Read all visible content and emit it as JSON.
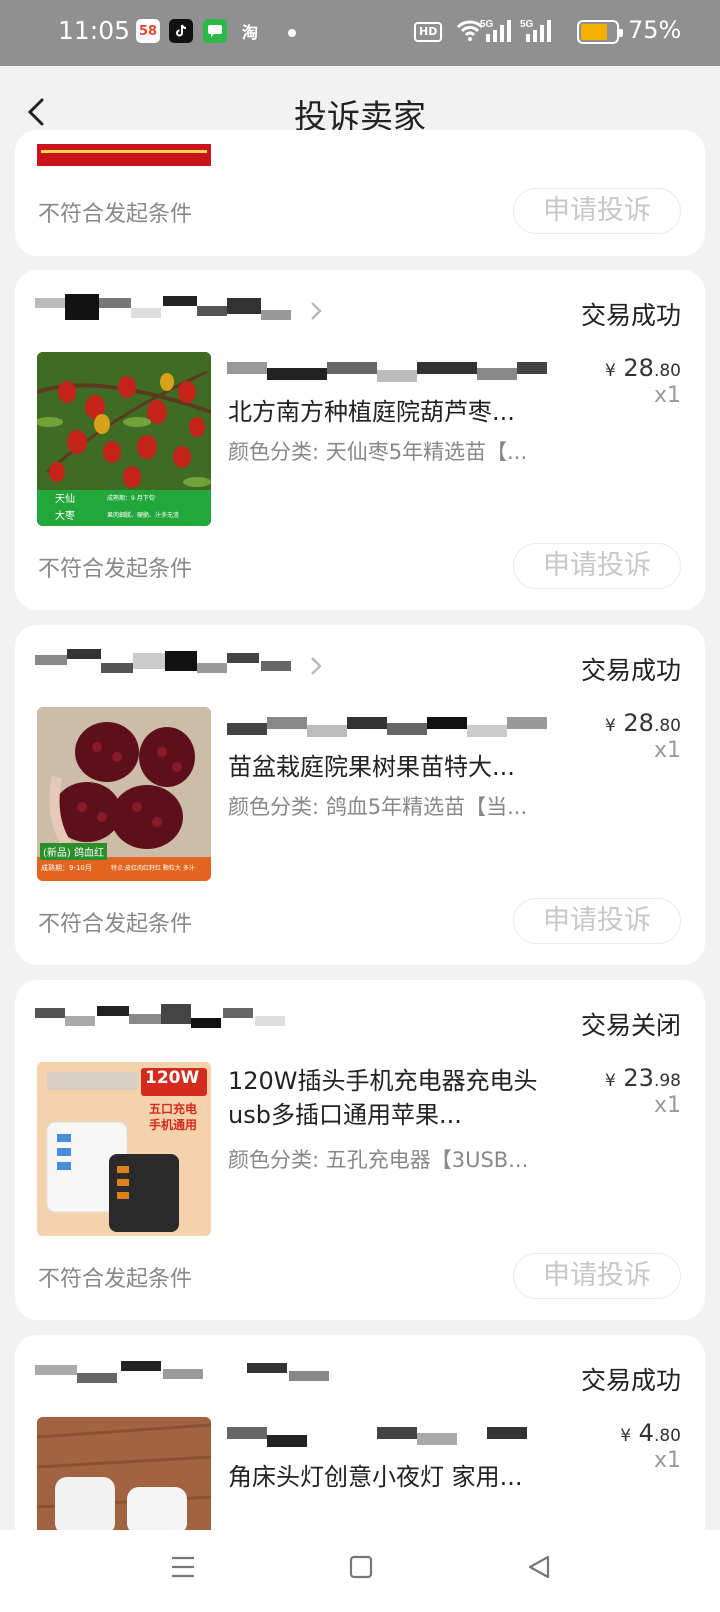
{
  "status_bar": {
    "time": "11:05",
    "apps": [
      "58",
      "douyin-icon",
      "chat-icon",
      "淘"
    ],
    "network": "HD",
    "signal": [
      "5G",
      "5G"
    ],
    "battery": "75%",
    "battery_level": 0.75
  },
  "header": {
    "title": "投诉卖家",
    "back_icon": "chevron-left-icon"
  },
  "orders": [
    {
      "status": "",
      "title": "",
      "sku": "",
      "condition": "不符合发起条件",
      "button": "申请投诉"
    },
    {
      "status": "交易成功",
      "title": "北方南方种植庭院葫芦枣...",
      "sku": "颜色分类: 天仙枣5年精选苗【...",
      "price_symbol": "¥",
      "price_int": "28",
      "price_dec": ".80",
      "qty": "x1",
      "thumb_label_1": "天仙",
      "thumb_label_2": "大枣",
      "thumb_note_1": "成熟期：9 月下旬",
      "thumb_note_2": "果肉细腻、硬脆、汁多无渣",
      "condition": "不符合发起条件",
      "button": "申请投诉"
    },
    {
      "status": "交易成功",
      "title": "苗盆栽庭院果树果苗特大...",
      "sku": "颜色分类: 鸽血5年精选苗【当...",
      "price_symbol": "¥",
      "price_int": "28",
      "price_dec": ".80",
      "qty": "x1",
      "thumb_label_1": "(新品) 鸽血红",
      "thumb_note_1": "成熟期：9-10月",
      "thumb_note_2": "特点:皮红肉红籽红 颗粒大 多汁",
      "condition": "不符合发起条件",
      "button": "申请投诉"
    },
    {
      "status": "交易关闭",
      "title": "120W插头手机充电器充电头usb多插口通用苹果...",
      "sku": "颜色分类: 五孔充电器【3USB...",
      "price_symbol": "¥",
      "price_int": "23",
      "price_dec": ".98",
      "qty": "x1",
      "thumb_badge": "120W",
      "thumb_line_1": "五口充电",
      "thumb_line_2": "手机通用",
      "condition": "不符合发起条件",
      "button": "申请投诉"
    },
    {
      "status": "交易成功",
      "title": "角床头灯创意小夜灯 家用...",
      "price_symbol": "¥",
      "price_int": "4",
      "price_dec": ".80",
      "qty": "x1"
    }
  ],
  "nav_bar": {
    "icons": [
      "menu-icon",
      "home-icon",
      "back-triangle-icon"
    ]
  },
  "colors": {
    "accent_green": "#22a83a",
    "status_bar_bg": "#909090",
    "battery": "#f6b000"
  }
}
